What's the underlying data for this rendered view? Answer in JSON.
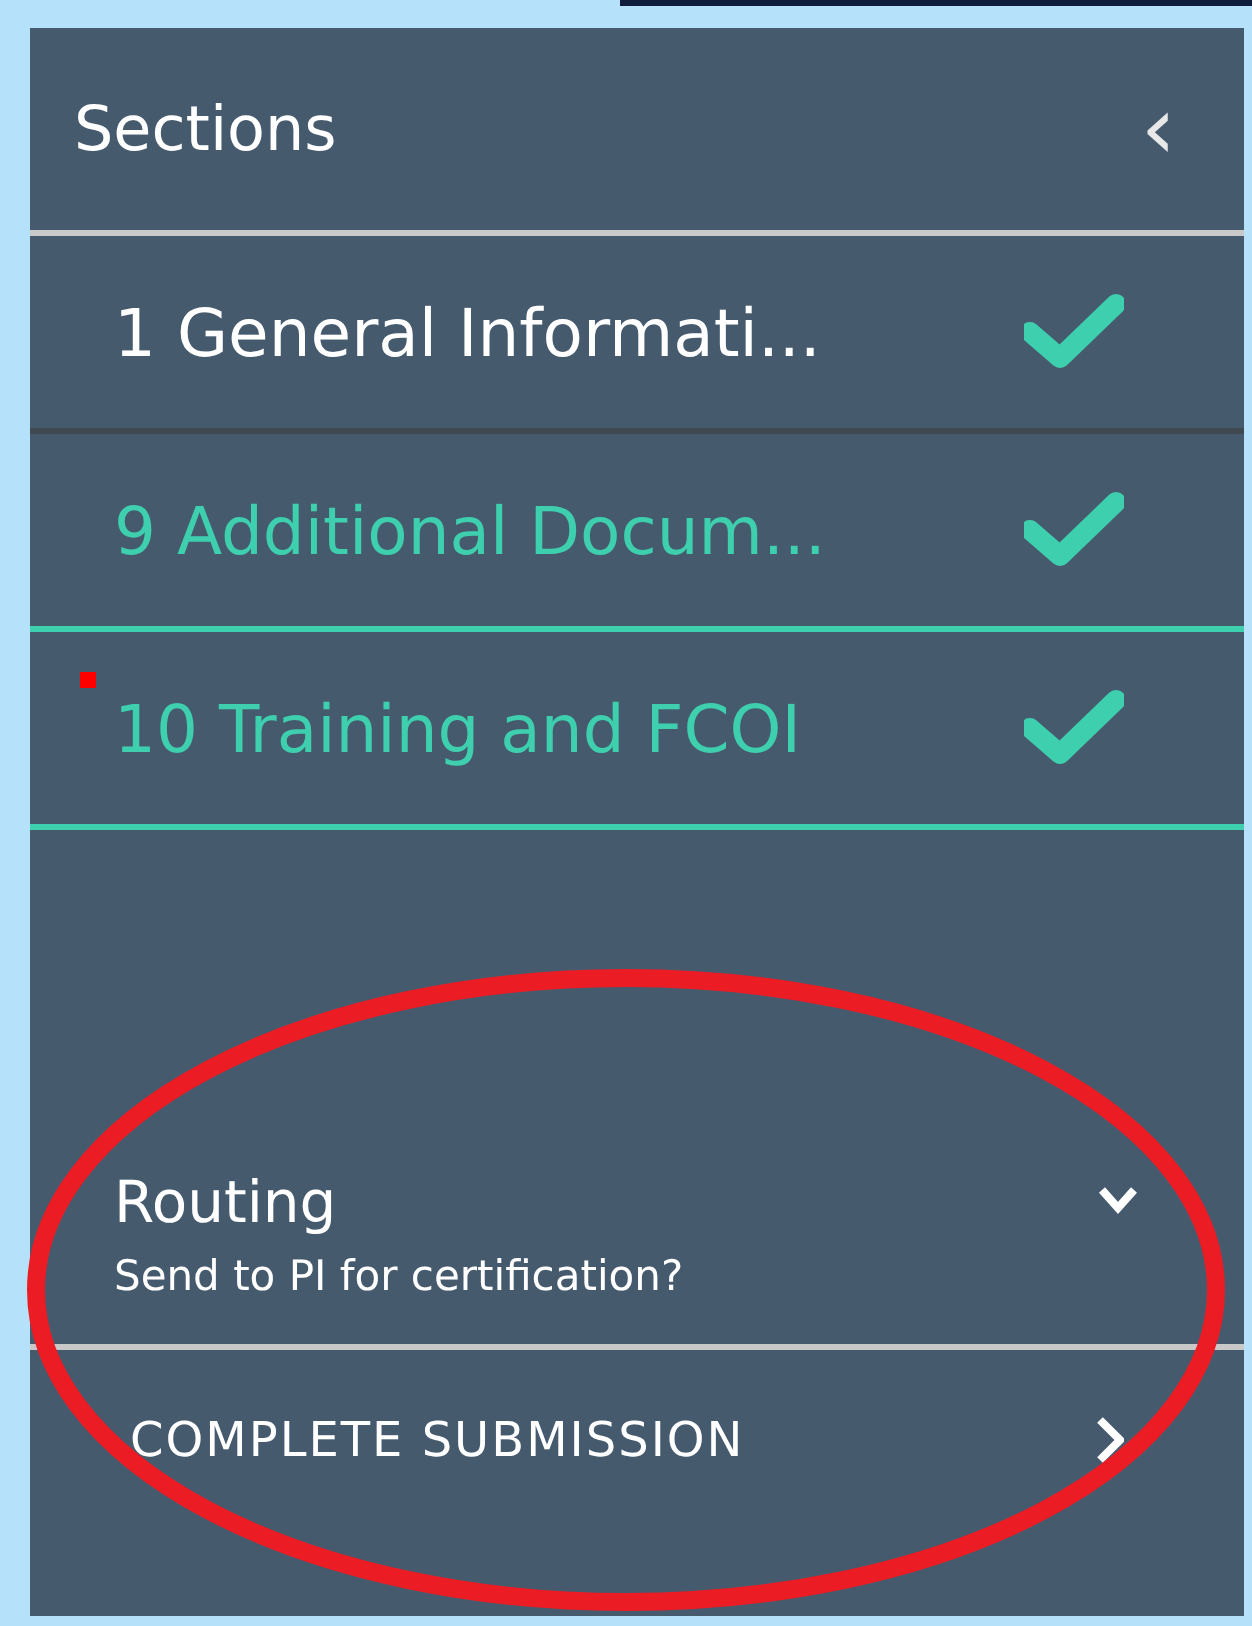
{
  "panel": {
    "title": "Sections",
    "collapse_icon": "‹"
  },
  "sections": [
    {
      "label": "1 General Informati...",
      "checked": true,
      "highlighted": false,
      "flagged": false
    },
    {
      "label": "9 Additional Docum...",
      "checked": true,
      "highlighted": true,
      "flagged": false
    },
    {
      "label": "10 Training and FCOI",
      "checked": true,
      "highlighted": true,
      "flagged": true
    }
  ],
  "routing": {
    "title": "Routing",
    "subtitle": "Send to PI for certification?",
    "expanded": false
  },
  "action": {
    "label": "COMPLETE SUBMISSION"
  },
  "annotation": {
    "kind": "ellipse",
    "color": "#ec1c24"
  }
}
